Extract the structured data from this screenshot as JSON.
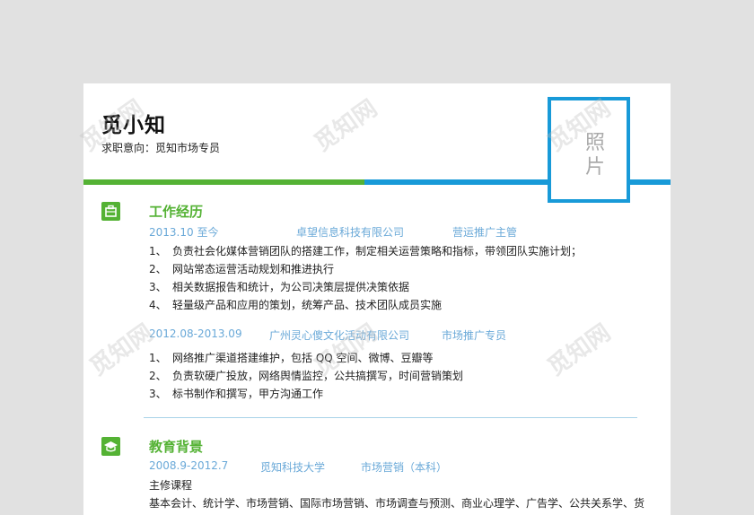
{
  "name": "觅小知",
  "intent": "求职意向：觅知市场专员",
  "photo_label": "照片",
  "watermark": "觅知网",
  "sections": {
    "work": {
      "title": "工作经历",
      "jobs": [
        {
          "date": "2013.10 至今",
          "company": "卓望信息科技有限公司",
          "role": "营运推广主管",
          "items": [
            {
              "num": "1、",
              "text": "负责社会化媒体营销团队的搭建工作，制定相关运营策略和指标，带领团队实施计划；"
            },
            {
              "num": "2、",
              "text": "网站常态运营活动规划和推进执行"
            },
            {
              "num": "3、",
              "text": "相关数据报告和统计，为公司决策层提供决策依据"
            },
            {
              "num": "4、",
              "text": "轻量级产品和应用的策划，统筹产品、技术团队成员实施"
            }
          ]
        },
        {
          "date": "2012.08-2013.09",
          "company": "广州灵心傻文化活动有限公司",
          "role": "市场推广专员",
          "items": [
            {
              "num": "1、",
              "text": "网络推广渠道搭建维护，包括 QQ 空间、微博、豆瓣等"
            },
            {
              "num": "2、",
              "text": "负责软硬广投放，网络舆情监控，公共搞撰写，时间营销策划"
            },
            {
              "num": "3、",
              "text": "标书制作和撰写，甲方沟通工作"
            }
          ]
        }
      ]
    },
    "education": {
      "title": "教育背景",
      "date": "2008.9-2012.7",
      "school": "觅知科技大学",
      "major": "市场营销（本科）",
      "courses_label": "主修课程",
      "courses": "基本会计、统计学、市场营销、国际市场营销、市场调查与预测、商业心理学、广告学、公共关系学、货"
    }
  },
  "colors": {
    "green": "#54b234",
    "blue": "#189ad8",
    "meta": "#6aa9d8"
  }
}
